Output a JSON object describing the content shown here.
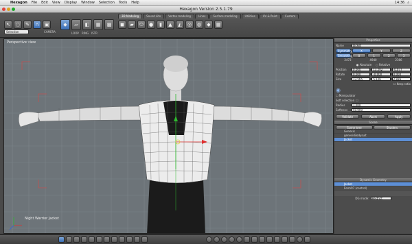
{
  "menubar": {
    "app": "Hexagon",
    "items": [
      "File",
      "Edit",
      "View",
      "Display",
      "Window",
      "Selection",
      "Tools",
      "Help"
    ],
    "clock": "14:36"
  },
  "window": {
    "title": "Hexagon Version 2.5.1.79"
  },
  "toolbar": {
    "tabs": [
      "3D Modeling",
      "Sound Life",
      "Vertex modeling",
      "Lines",
      "Surface modeling",
      "Utilities",
      "UV & Paint",
      "Custom"
    ],
    "active_tab": 0,
    "selection_value": "Selection",
    "loop_label": "LOOP",
    "ring_label": "RING",
    "istr_label": "ISTR",
    "camera_label": "CAMERA"
  },
  "viewport": {
    "title": "Perspective view",
    "object_label": "Night Warrior Jacket",
    "background": "#6d7479"
  },
  "properties": {
    "title": "Properties",
    "name_label": "Name",
    "name_value": "Jacket",
    "symmetry_label": "Symmetry",
    "axes": [
      "X",
      "Y",
      "Z"
    ],
    "smoothing_label": "Smoothing",
    "smoothing_values": [
      "0",
      "1",
      "2",
      "3"
    ],
    "stats": [
      "2473",
      "4940",
      "2366"
    ],
    "absolute_label": "Absolute",
    "relative_label": "Relative",
    "position_label": "Position",
    "position": [
      "0.000",
      "13.202",
      "-0.077"
    ],
    "rotate_label": "Rotate",
    "rotate": [
      "0.000",
      "-0.000",
      "0.000"
    ],
    "size_label": "Size",
    "size": [
      "13.565",
      "5.126",
      "2.836"
    ],
    "keep_ratio_label": "Keep ratio",
    "manipulator_label": "Manipulator",
    "soft_selection_label": "Soft selection",
    "radius_label": "Radius",
    "radius_value": "1.000",
    "softness_label": "Softness",
    "softness_value": "50.000",
    "validate_label": "Validate",
    "abort_label": "Abort",
    "apply_label": "Apply"
  },
  "scene": {
    "title": "Scene",
    "tabs": [
      "Scene tree",
      "Shaders"
    ],
    "items": [
      "Genesis",
      "genesisBodysuit",
      "Jacket"
    ],
    "selected": 2
  },
  "dynamic": {
    "title": "Dynamic Geometry",
    "items": [
      "Jacket",
      "Form97 (control)"
    ],
    "selected": 0,
    "dg_mode_label": "DG mode:",
    "dg_mode_value": "Restrict"
  },
  "colors": {
    "accent": "#5d8fd6",
    "panel": "#4c4c4c",
    "viewport": "#6d7479"
  }
}
